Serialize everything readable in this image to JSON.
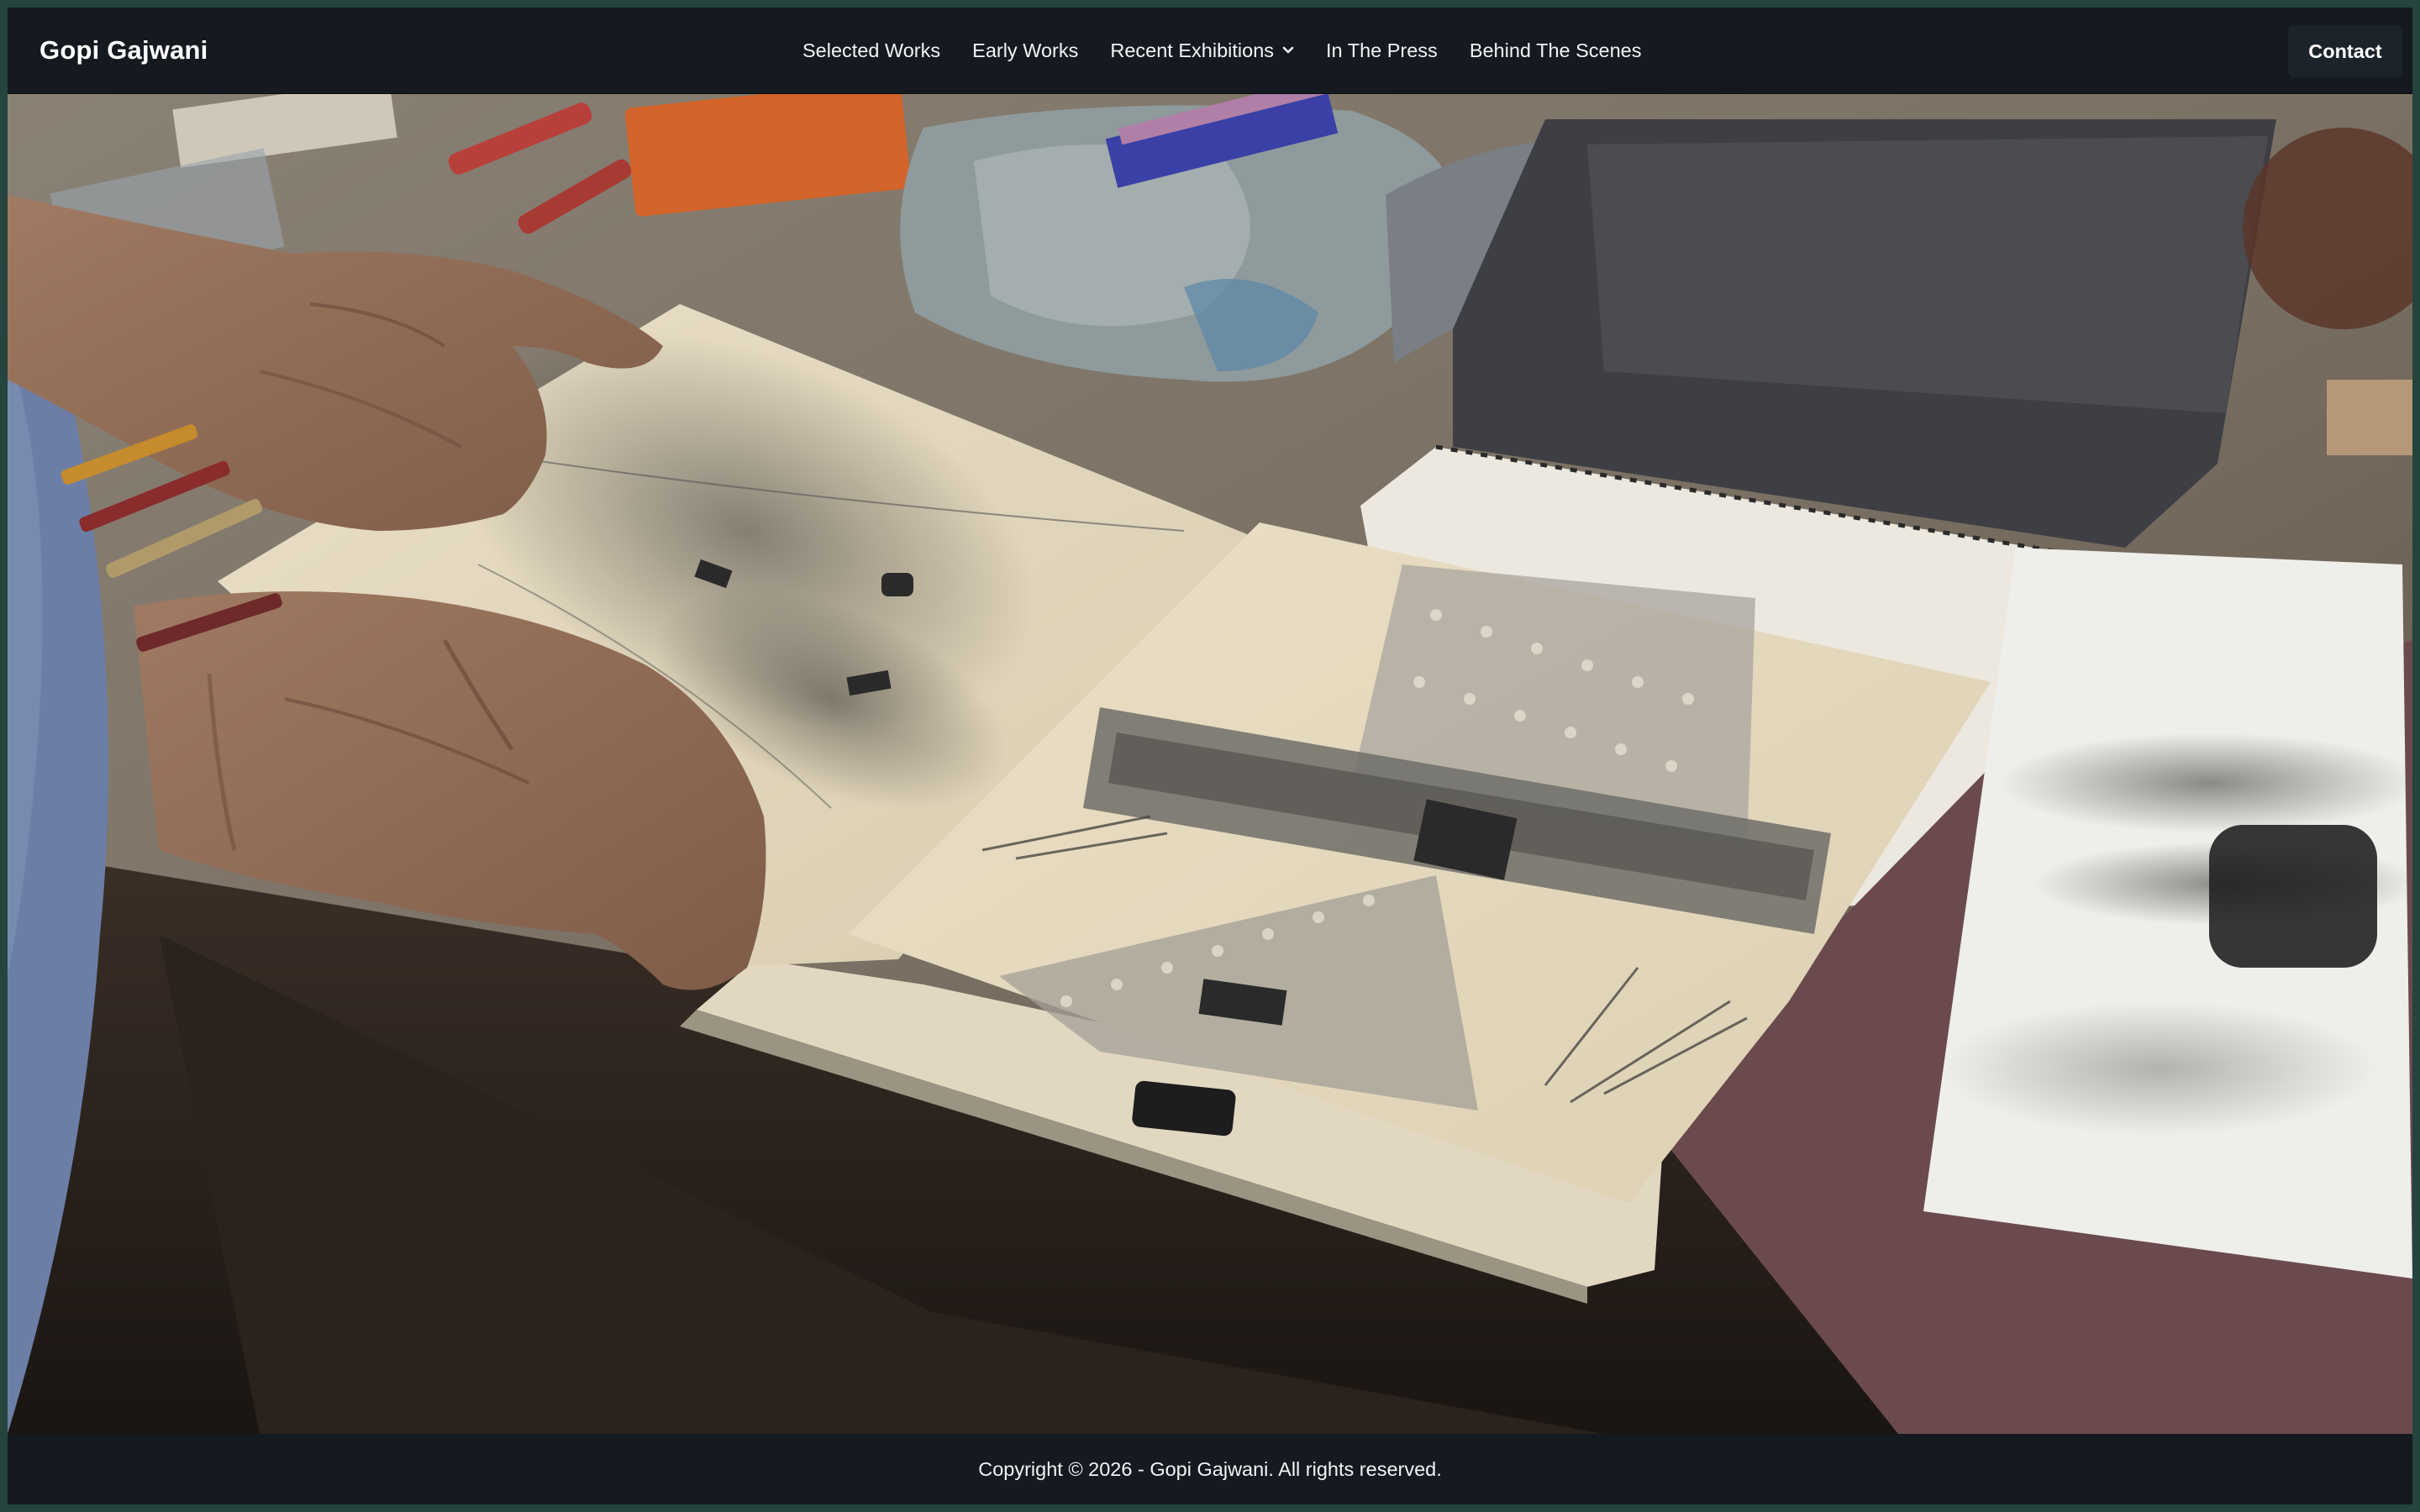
{
  "site": {
    "title": "Gopi Gajwani"
  },
  "nav": {
    "items": [
      {
        "label": "Selected Works"
      },
      {
        "label": "Early Works"
      },
      {
        "label": "Recent Exhibitions",
        "has_dropdown": true
      },
      {
        "label": "In The Press"
      },
      {
        "label": "Behind The Scenes"
      }
    ],
    "contact_label": "Contact"
  },
  "hero": {
    "icon": "hero-photo",
    "description_visible": false
  },
  "footer": {
    "copyright": "Copyright © 2026 - Gopi Gajwani. All rights reserved."
  },
  "colors": {
    "header_bg": "#151a20",
    "outer_border": "#24443d",
    "text": "#ffffff"
  }
}
